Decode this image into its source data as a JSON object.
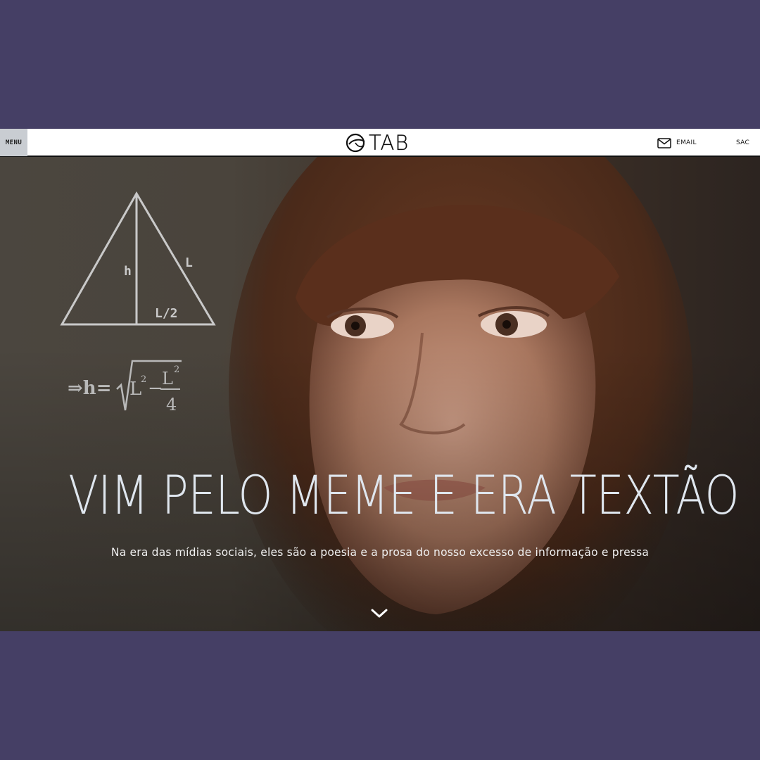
{
  "header": {
    "menu_label": "MENU",
    "logo_text": "TAB",
    "email_label": "EMAIL",
    "sac_label": "SAC"
  },
  "hero": {
    "headline": "VIM PELO MEME E ERA TEXTÃO",
    "subtitle": "Na era das mídias sociais, eles são a poesia e a prosa do nosso excesso de informação e pressa",
    "scroll_icon": "chevron-down-icon"
  },
  "diagram": {
    "label_h": "h",
    "label_l": "L",
    "label_half": "L/2",
    "formula_prefix": "⇒h=",
    "formula_l2": "L",
    "formula_minus": "−",
    "formula_num": "L",
    "formula_den": "4",
    "formula_exp": "2"
  },
  "colors": {
    "background": "#453f65",
    "topbar": "#ffffff",
    "menu_button": "#c9cdd2",
    "headline": "#dfe6ee"
  }
}
